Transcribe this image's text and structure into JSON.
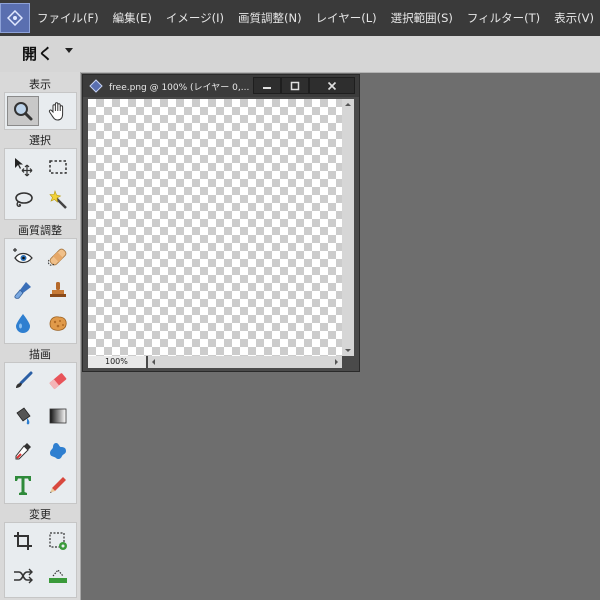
{
  "menubar": {
    "items": [
      "ファイル(F)",
      "編集(E)",
      "イメージ(I)",
      "画質調整(N)",
      "レイヤー(L)",
      "選択範囲(S)",
      "フィルター(T)",
      "表示(V)"
    ]
  },
  "optionsbar": {
    "open_label": "開く"
  },
  "toolbox": {
    "sections": {
      "view": "表示",
      "select": "選択",
      "enhance": "画質調整",
      "draw": "描画",
      "modify": "変更"
    }
  },
  "document": {
    "title": "free.png @ 100% (レイヤー 0,...",
    "zoom": "100%"
  }
}
